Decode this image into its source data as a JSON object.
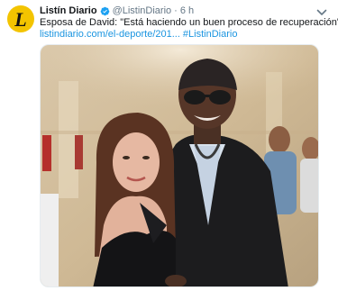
{
  "tweet": {
    "author_name": "Listín Diario",
    "handle": "@ListinDiario",
    "separator": "·",
    "time": "6 h",
    "text": "Esposa de David: \"Está haciendo un buen proceso de recuperación\"",
    "link": "listindiario.com/el-deporte/201...",
    "hashtag": "#ListinDiario",
    "avatar_letter": "L"
  },
  "icons": {
    "verified": "verified-badge-icon",
    "more": "chevron-down-icon"
  },
  "colors": {
    "link": "#1b95e0",
    "avatar_bg": "#f3c400",
    "name": "#14171a",
    "meta": "#657786"
  }
}
